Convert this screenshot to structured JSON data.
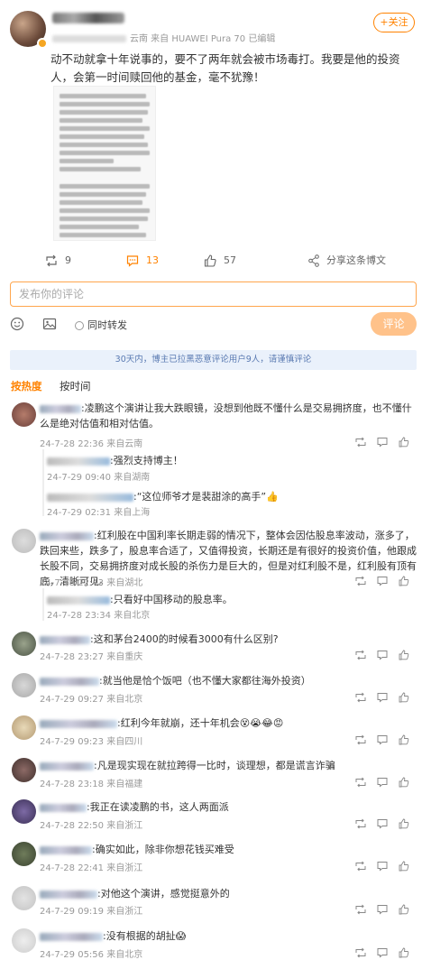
{
  "post": {
    "meta_suffix": "云南 来自 HUAWEI Pura 70 已编辑",
    "follow_label": "+关注",
    "body": "动不动就拿十年说事的，要不了两年就会被市场毒打。我要是他的投资人，会第一时间赎回他的基金，毫不犹豫！",
    "stats": {
      "reposts": "9",
      "comments": "13",
      "likes": "57",
      "share_label": "分享这条博文"
    }
  },
  "composer": {
    "placeholder": "发布你的评论",
    "repost_label": "同时转发",
    "submit_label": "评论"
  },
  "notice": "30天内，博主已拉黑恶意评论用户9人，请谨慎评论",
  "sort": {
    "hot": "按热度",
    "time": "按时间"
  },
  "comments": [
    {
      "text": ":凌鹏这个演讲让我大跌眼镜，没想到他既不懂什么是交易拥挤度，也不懂什么是绝对估值和相对估值。",
      "meta": "24-7-28 22:36 来自云南",
      "replies": [
        {
          "text": ":强烈支持博主！",
          "meta": "24-7-29 09:40 来自湖南"
        },
        {
          "text": ":“这位师爷才是裴甜涂的高手”👍",
          "meta": "24-7-29 02:31 来自上海"
        }
      ]
    },
    {
      "text": ":红利股在中国利率长期走弱的情况下，整体会因估股息率波动，涨多了，跌回来些，跌多了，股息率合适了，又值得投资，长期还是有很好的投资价值，他跟成长股不同，交易拥挤度对成长股的杀伤力是巨大的，但是对红利股不是，红利股有顶有底，清晰可见。",
      "meta": "24-7-28 22:43 来自湖北",
      "replies": [
        {
          "text": ":只看好中国移动的股息率。",
          "meta": "24-7-28 23:34 来自北京"
        }
      ]
    },
    {
      "text": ":这和茅台2400的时候看3000有什么区别?",
      "meta": "24-7-28 23:27 来自重庆",
      "replies": []
    },
    {
      "text": ":就当他是恰个饭吧（也不懂大家都往海外投资）",
      "meta": "24-7-29 09:27 来自北京",
      "replies": []
    },
    {
      "text": ":红利今年就崩，还十年机会😵😭😂😡",
      "meta": "24-7-29 09:23 来自四川",
      "replies": []
    },
    {
      "text": ":凡是现实现在就拉跨得一比时，谈理想，都是谎言诈骗",
      "meta": "24-7-28 23:18 来自福建",
      "replies": []
    },
    {
      "text": ":我正在读凌鹏的书，这人两面派",
      "meta": "24-7-28 22:50 来自浙江",
      "replies": []
    },
    {
      "text": ":确实如此，除非你想花钱买难受",
      "meta": "24-7-28 22:41 来自浙江",
      "replies": []
    },
    {
      "text": ":对他这个演讲，感觉挺意外的",
      "meta": "24-7-29 09:19 来自浙江",
      "replies": []
    },
    {
      "text": ":没有根据的胡扯😱",
      "meta": "24-7-29 05:56 来自北京",
      "replies": []
    }
  ],
  "colors": {
    "accent": "#ff8200",
    "notice_bg": "#eaf1fb",
    "notice_text": "#5a7ab2"
  },
  "icons": [
    "repost-icon",
    "comment-icon",
    "like-icon",
    "share-icon",
    "emoji-icon",
    "image-icon",
    "reply-icon",
    "more-icon"
  ]
}
